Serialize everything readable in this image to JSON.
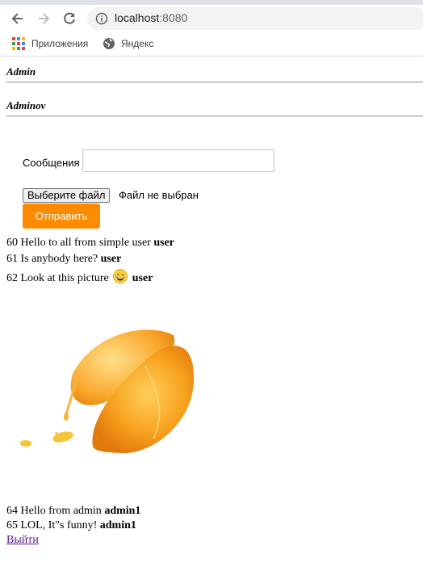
{
  "browser": {
    "url_host": "localhost",
    "url_port": ":8080",
    "bookmarks": [
      {
        "label": "Приложения",
        "icon": "apps-icon"
      },
      {
        "label": "Яндекс",
        "icon": "globe-icon"
      }
    ]
  },
  "users": [
    "Admin",
    "Adminov"
  ],
  "form": {
    "label": "Сообщения",
    "input_value": "",
    "file_button": "Выберите файл",
    "file_status": "Файл не выбран",
    "submit": "Отправить"
  },
  "messages": [
    {
      "id": "60",
      "text": "Hello to all from simple user",
      "author": "user"
    },
    {
      "id": "61",
      "text": "Is anybody here?",
      "author": "user"
    },
    {
      "id": "62",
      "text": "Look at this picture",
      "emoji": "grinning-face-emoji",
      "author": "user"
    },
    {
      "id": "64",
      "text": "Hello from admin",
      "author": "admin1"
    },
    {
      "id": "65",
      "text": "LOL, It\"s funny!",
      "author": "admin1"
    }
  ],
  "logout": "Выйти",
  "colors": {
    "accent": "#ff8c00",
    "link": "#551a8b"
  }
}
